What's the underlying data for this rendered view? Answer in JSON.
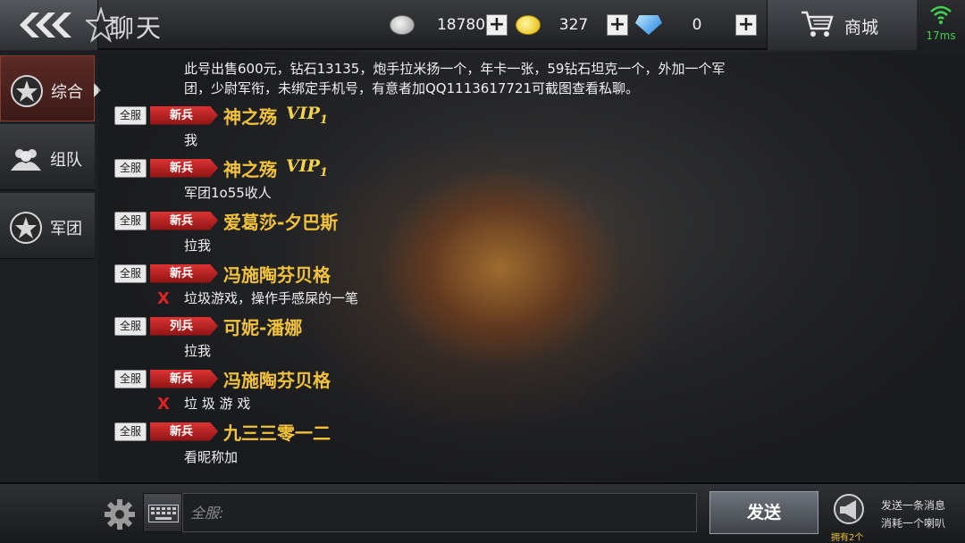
{
  "header": {
    "title": "聊天",
    "currencies": [
      {
        "name": "silver",
        "value": "18780",
        "icon": "silver-coin-icon"
      },
      {
        "name": "gold",
        "value": "327",
        "icon": "gold-coin-icon"
      },
      {
        "name": "diamond",
        "value": "0",
        "icon": "diamond-icon"
      }
    ],
    "plus_label": "+",
    "shop_label": "商城",
    "ping": "17ms"
  },
  "sidebar": {
    "items": [
      {
        "label": "综合",
        "active": true
      },
      {
        "label": "组队",
        "active": false
      },
      {
        "label": "军团",
        "active": false
      }
    ]
  },
  "chat": {
    "top_message_line1": "此号出售600元，钻石13135，炮手拉米扬一个，年卡一张，59钻石坦克一个，外加一个军",
    "top_message_line2": "团，少尉军衔，未绑定手机号，有意者加QQ1113617721可截图查看私聊。",
    "messages": [
      {
        "channel": "全服",
        "rank": "新兵",
        "name": "神之殇",
        "vip": "VIP",
        "vip_level": "1",
        "text": "我",
        "flag": ""
      },
      {
        "channel": "全服",
        "rank": "新兵",
        "name": "神之殇",
        "vip": "VIP",
        "vip_level": "1",
        "text": "军团1o55收人",
        "flag": ""
      },
      {
        "channel": "全服",
        "rank": "新兵",
        "name": "爱葛莎-夕巴斯",
        "vip": "",
        "vip_level": "",
        "text": "拉我",
        "flag": ""
      },
      {
        "channel": "全服",
        "rank": "新兵",
        "name": "冯施陶芬贝格",
        "vip": "",
        "vip_level": "",
        "text": "垃圾游戏，操作手感屎的一笔",
        "flag": "X"
      },
      {
        "channel": "全服",
        "rank": "列兵",
        "name": "可妮-潘娜",
        "vip": "",
        "vip_level": "",
        "text": "拉我",
        "flag": ""
      },
      {
        "channel": "全服",
        "rank": "新兵",
        "name": "冯施陶芬贝格",
        "vip": "",
        "vip_level": "",
        "text": "垃 圾 游 戏",
        "flag": "X"
      },
      {
        "channel": "全服",
        "rank": "新兵",
        "name": "九三三零一二",
        "vip": "",
        "vip_level": "",
        "text": "看昵称加",
        "flag": ""
      }
    ]
  },
  "footer": {
    "input_placeholder": "全服:",
    "send_label": "发送",
    "horn_count": "拥有2个",
    "horn_note_line1": "发送一条消息",
    "horn_note_line2": "消耗一个喇叭"
  },
  "colors": {
    "username": "#f2c23a",
    "rank_badge": "#c8201e",
    "ping": "#3fd24a",
    "active_tab": "#5b2a25"
  }
}
